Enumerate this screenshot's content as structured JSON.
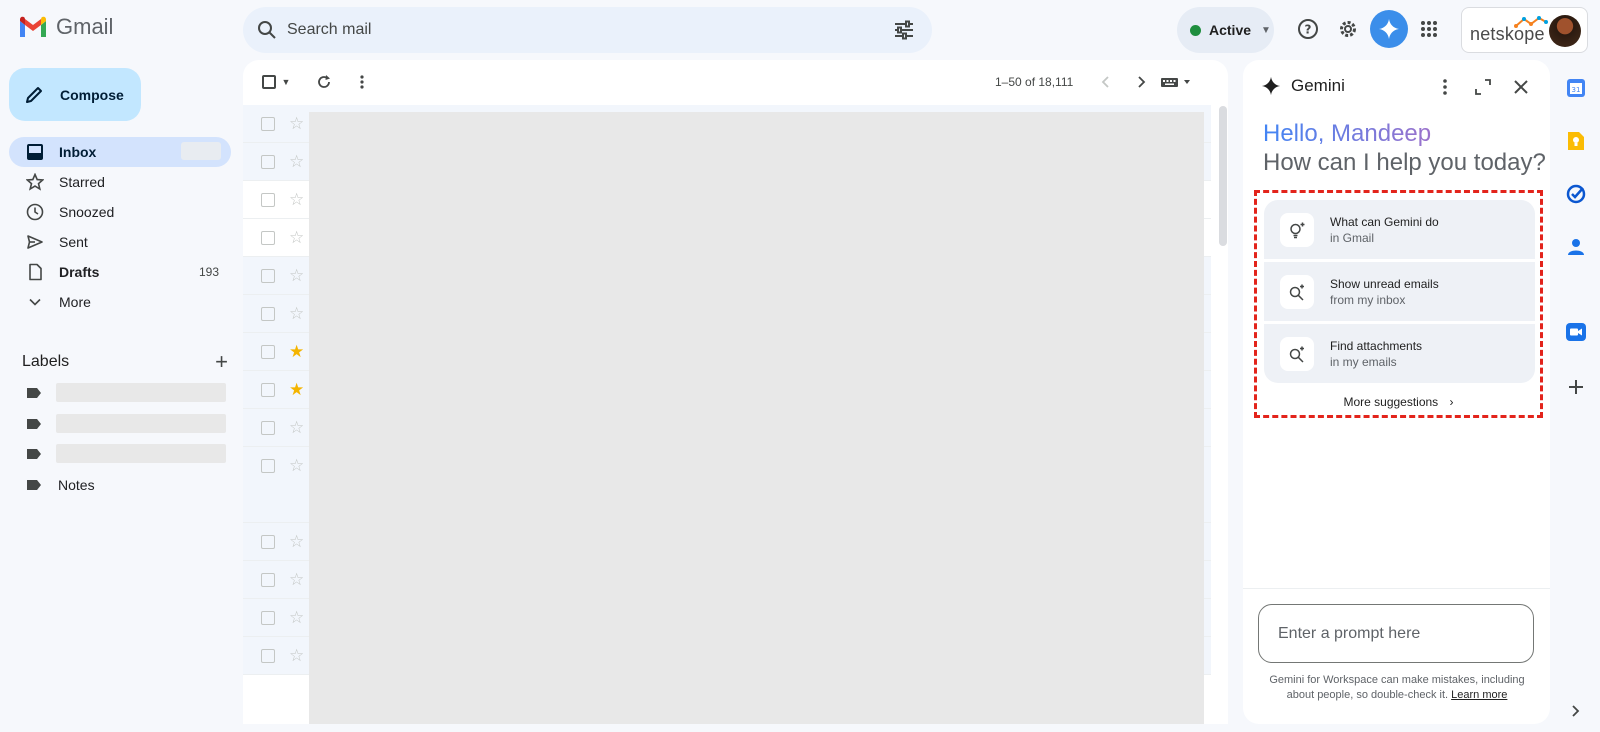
{
  "app": {
    "name": "Gmail"
  },
  "search": {
    "placeholder": "Search mail"
  },
  "status": {
    "label": "Active"
  },
  "account": {
    "brand": "netskope"
  },
  "compose": {
    "label": "Compose"
  },
  "nav": {
    "items": [
      {
        "label": "Inbox",
        "count": ""
      },
      {
        "label": "Starred",
        "count": ""
      },
      {
        "label": "Snoozed",
        "count": ""
      },
      {
        "label": "Sent",
        "count": ""
      },
      {
        "label": "Drafts",
        "count": "193"
      },
      {
        "label": "More",
        "count": ""
      }
    ]
  },
  "labels": {
    "title": "Labels",
    "items": [
      {
        "label": "Notes"
      }
    ]
  },
  "mail": {
    "pager": "1–50 of 18,111",
    "starred_rows": [
      6,
      7
    ]
  },
  "gemini": {
    "title": "Gemini",
    "greeting": "Hello, Mandeep",
    "subgreeting": "How can I help you today?",
    "suggestions": [
      {
        "title": "What can Gemini do",
        "subtitle": "in Gmail"
      },
      {
        "title": "Show unread emails",
        "subtitle": "from my inbox"
      },
      {
        "title": "Find attachments",
        "subtitle": "in my emails"
      }
    ],
    "more_suggestions": "More suggestions",
    "prompt_placeholder": "Enter a prompt here",
    "disclaimer": "Gemini for Workspace can make mistakes, including about people, so double-check it.",
    "learn_more": "Learn more"
  },
  "rail": {
    "calendar_day": "31"
  },
  "colors": {
    "accent": "#0b57d0",
    "compose_bg": "#c2e7ff",
    "active_nav": "#d3e3fd",
    "highlight_box": "#e3241b",
    "star": "#f4b400"
  }
}
